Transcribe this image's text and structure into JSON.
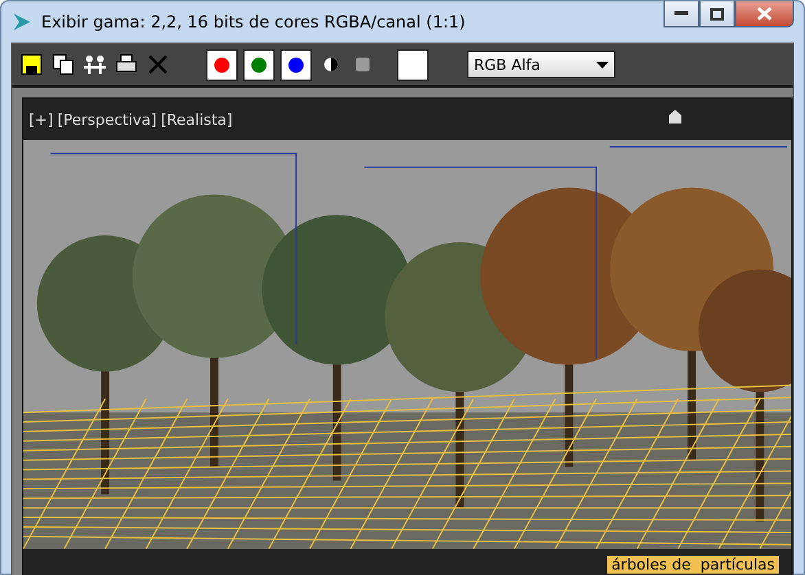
{
  "window": {
    "title": "Exibir gama: 2,2, 16 bits de cores RGBA/canal (1:1)"
  },
  "channels": [
    {
      "color": "#ff0000",
      "on": true
    },
    {
      "color": "#008000",
      "on": true
    },
    {
      "color": "#0000ff",
      "on": true
    }
  ],
  "channel_dropdown": {
    "value": "RGB Alfa"
  },
  "viewport": {
    "labels": [
      "[+]",
      "[Perspectiva]",
      "[Realista]"
    ],
    "object_label": "árboles de  partículas"
  }
}
